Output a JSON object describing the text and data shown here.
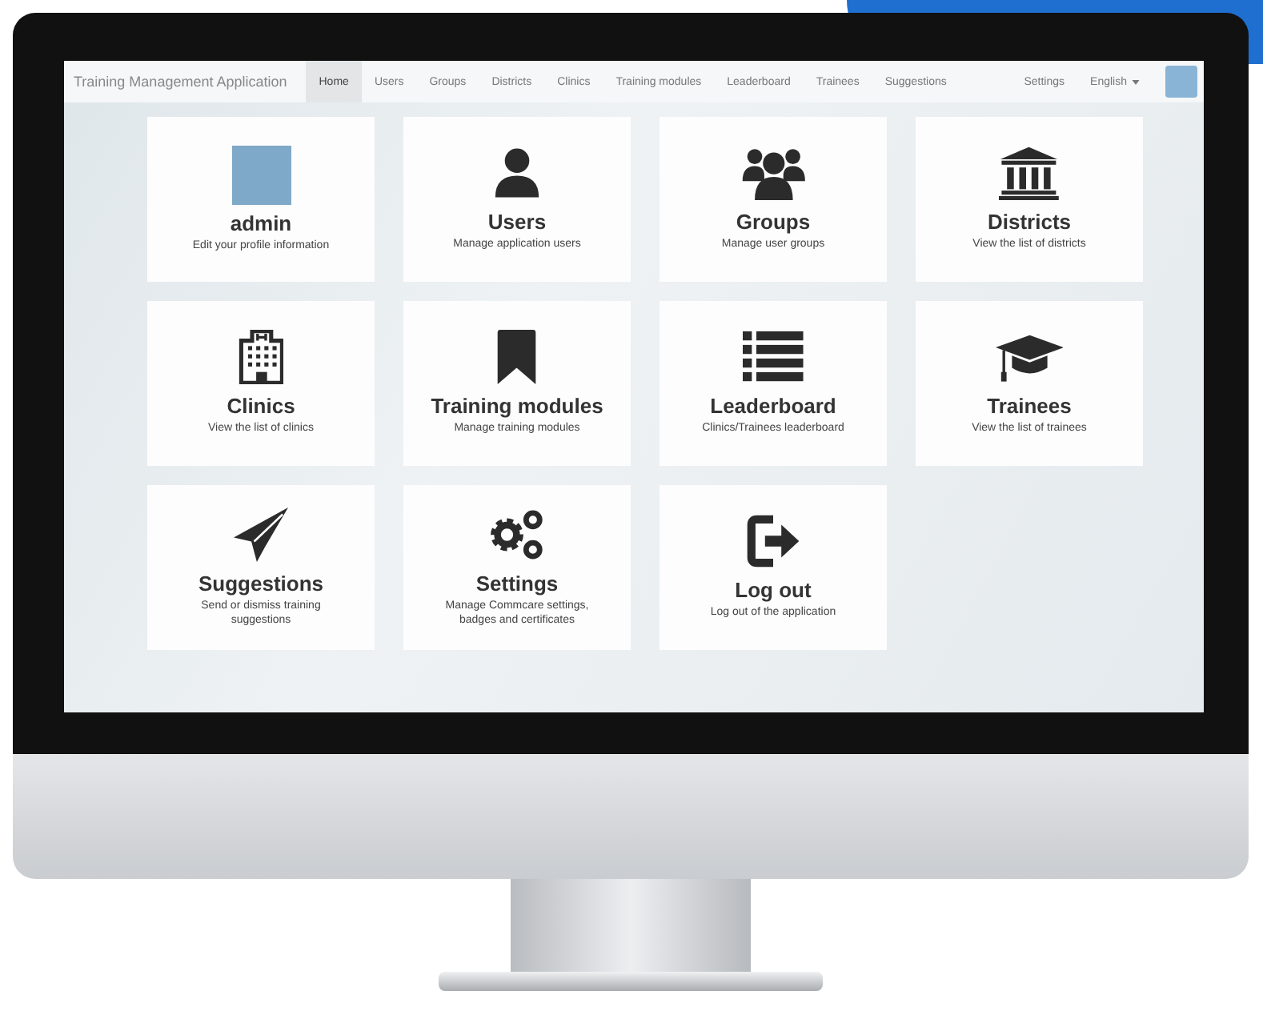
{
  "navbar": {
    "brand": "Training Management Application",
    "items": [
      {
        "label": "Home",
        "selected": true
      },
      {
        "label": "Users",
        "selected": false
      },
      {
        "label": "Groups",
        "selected": false
      },
      {
        "label": "Districts",
        "selected": false
      },
      {
        "label": "Clinics",
        "selected": false
      },
      {
        "label": "Training modules",
        "selected": false
      },
      {
        "label": "Leaderboard",
        "selected": false
      },
      {
        "label": "Trainees",
        "selected": false
      },
      {
        "label": "Suggestions",
        "selected": false
      }
    ],
    "settings": "Settings",
    "language": "English"
  },
  "tiles": [
    {
      "kind": "profile",
      "title": "admin",
      "subtitle": "Edit your profile information"
    },
    {
      "kind": "user",
      "title": "Users",
      "subtitle": "Manage application users"
    },
    {
      "kind": "group",
      "title": "Groups",
      "subtitle": "Manage user groups"
    },
    {
      "kind": "building",
      "title": "Districts",
      "subtitle": "View the list of districts"
    },
    {
      "kind": "hospital",
      "title": "Clinics",
      "subtitle": "View the list of clinics"
    },
    {
      "kind": "bookmark",
      "title": "Training modules",
      "subtitle": "Manage training modules"
    },
    {
      "kind": "list",
      "title": "Leaderboard",
      "subtitle": "Clinics/Trainees leaderboard"
    },
    {
      "kind": "cap",
      "title": "Trainees",
      "subtitle": "View the list of trainees"
    },
    {
      "kind": "plane",
      "title": "Suggestions",
      "subtitle": "Send or dismiss training suggestions"
    },
    {
      "kind": "gears",
      "title": "Settings",
      "subtitle": "Manage Commcare settings, badges and certificates"
    },
    {
      "kind": "logout",
      "title": "Log out",
      "subtitle": "Log out of the application"
    }
  ]
}
